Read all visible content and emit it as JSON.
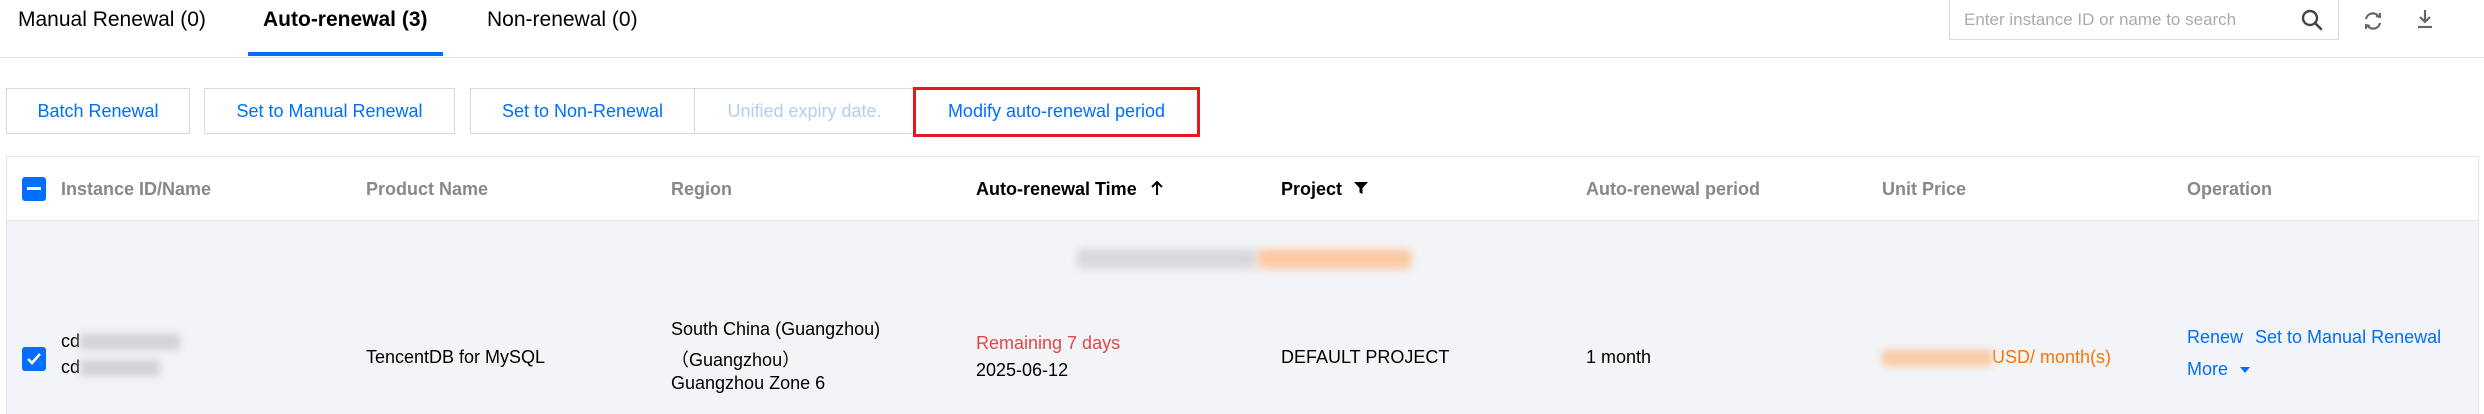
{
  "tabs": [
    {
      "label": "Manual Renewal (0)"
    },
    {
      "label": "Auto-renewal (3)"
    },
    {
      "label": "Non-renewal (0)"
    }
  ],
  "search": {
    "placeholder": "Enter instance ID or name to search"
  },
  "toolbar": {
    "batch_renewal": "Batch Renewal",
    "set_manual": "Set to Manual Renewal",
    "set_non_renewal": "Set to Non-Renewal",
    "unified_expiry": "Unified expiry date.",
    "modify_period": "Modify auto-renewal period"
  },
  "table": {
    "columns": {
      "instance": "Instance ID/Name",
      "product": "Product Name",
      "region": "Region",
      "auto_time": "Auto-renewal Time",
      "project": "Project",
      "period": "Auto-renewal period",
      "price": "Unit Price",
      "operation": "Operation"
    },
    "row": {
      "instance_line1": "cd",
      "instance_line2": "cd",
      "product": "TencentDB for MySQL",
      "region_line1": "South China (Guangzhou)",
      "region_line2": "（Guangzhou）",
      "region_line3": "Guangzhou Zone 6",
      "remaining": "Remaining 7 days",
      "date": "2025-06-12",
      "project": "DEFAULT PROJECT",
      "period": "1 month",
      "price_unit": "USD/ month(s)",
      "renew": "Renew",
      "set_manual": "Set to Manual Renewal",
      "more": "More"
    }
  },
  "colors": {
    "accent": "#006eff",
    "warning_red": "#e54545",
    "price_orange": "#ff7200",
    "highlight_red": "#e8161d"
  }
}
